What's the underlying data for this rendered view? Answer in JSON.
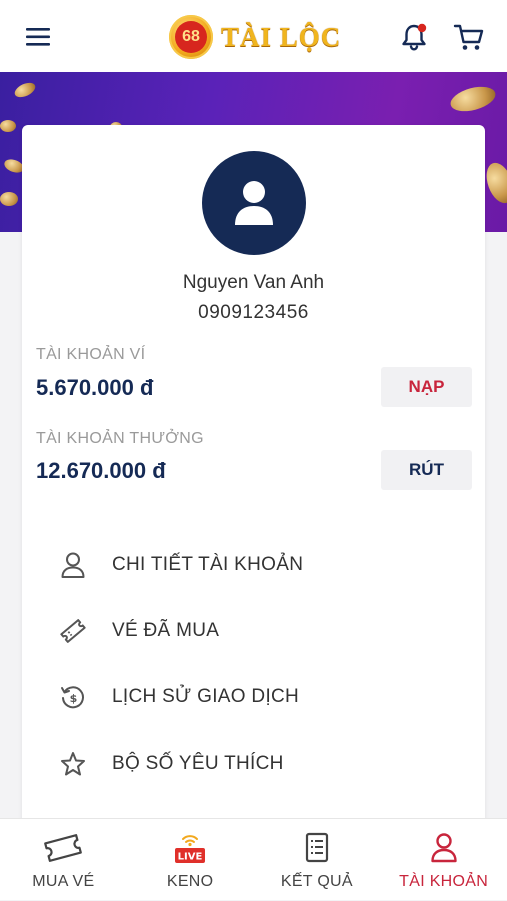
{
  "header": {
    "logo_badge": "68",
    "logo_text": "TÀI LỘC",
    "notification_dot_color": "#d7261e",
    "icons": [
      "hamburger-menu-icon",
      "bell-icon",
      "cart-icon"
    ]
  },
  "profile": {
    "name": "Nguyen Van Anh",
    "phone": "0909123456",
    "avatar_icon": "user-icon"
  },
  "accounts": [
    {
      "label": "TÀI KHOẢN VÍ",
      "value": "5.670.000 đ",
      "action": "NẠP"
    },
    {
      "label": "TÀI KHOẢN THƯỞNG",
      "value": "12.670.000 đ",
      "action": "RÚT"
    }
  ],
  "menu": [
    {
      "label": "CHI TIẾT TÀI KHOẢN",
      "icon": "user-outline-icon"
    },
    {
      "label": "VÉ ĐÃ MUA",
      "icon": "ticket-icon"
    },
    {
      "label": "LỊCH SỬ GIAO DỊCH",
      "icon": "history-dollar-icon"
    },
    {
      "label": "BỘ SỐ YÊU THÍCH",
      "icon": "star-icon"
    }
  ],
  "bottom_nav": [
    {
      "label": "MUA VÉ",
      "icon": "ticket-icon",
      "active": false
    },
    {
      "label": "KENO",
      "icon": "live-icon",
      "badge": "LIVE",
      "active": false
    },
    {
      "label": "KẾT QUẢ",
      "icon": "results-list-icon",
      "active": false
    },
    {
      "label": "TÀI KHOẢN",
      "icon": "user-outline-icon",
      "active": true
    }
  ],
  "colors": {
    "primary_navy": "#152a55",
    "accent_red": "#c8253c",
    "banner_purple": "#5a22b8"
  }
}
